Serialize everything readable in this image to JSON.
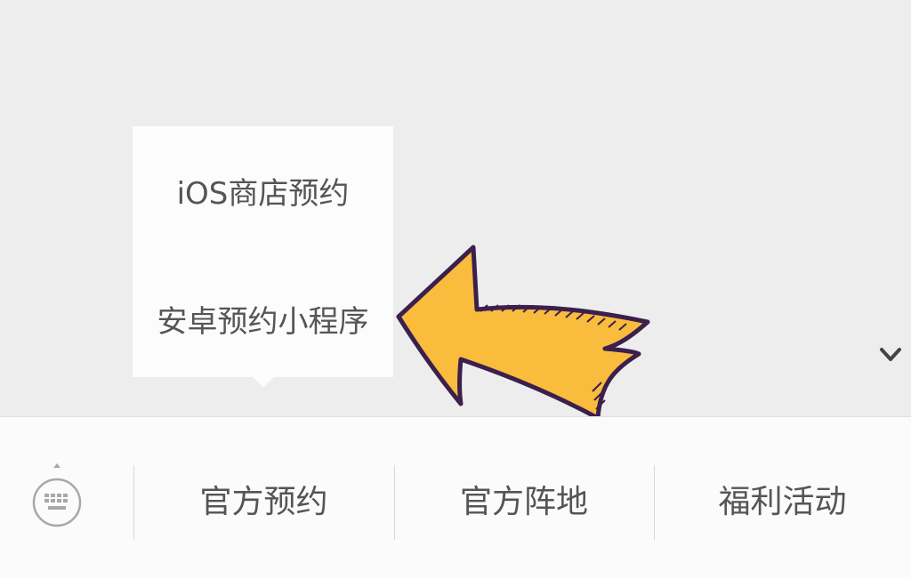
{
  "submenu": {
    "items": [
      {
        "label": "iOS商店预约"
      },
      {
        "label": "安卓预约小程序"
      }
    ]
  },
  "menu_bar": {
    "keyboard_icon": "keyboard-icon",
    "buttons": [
      {
        "label": "官方预约"
      },
      {
        "label": "官方阵地"
      },
      {
        "label": "福利活动"
      }
    ]
  },
  "annotation": {
    "arrow_icon": "hand-drawn-arrow-icon",
    "arrow_fill": "#f9bc3c",
    "arrow_stroke": "#3b1f4d"
  },
  "colors": {
    "background": "#ededed",
    "menu_background": "#fbfbfb",
    "text": "#555555"
  }
}
